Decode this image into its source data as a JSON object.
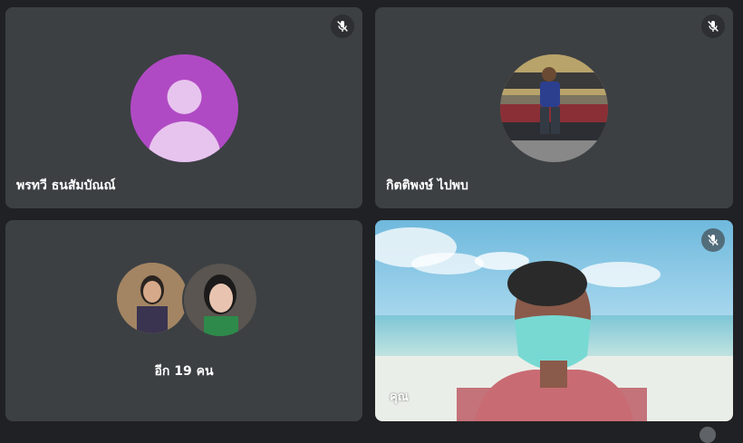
{
  "participants": [
    {
      "name": "พรทวี ธนสัมบัณณ์",
      "muted": true,
      "avatar": "default-person-avatar",
      "avatar_color": "#b04ac4"
    },
    {
      "name": "กิตติพงษ์ ไปพบ",
      "muted": true,
      "avatar": "photo-avatar"
    }
  ],
  "others": {
    "label": "อีก 19 คน",
    "avatars": [
      "photo-avatar-woman-1",
      "photo-avatar-woman-2"
    ]
  },
  "self": {
    "label": "คุณ",
    "muted": true,
    "video": "self-video-beach-background"
  },
  "icons": {
    "mute": "mic-off-icon"
  },
  "colors": {
    "tile_bg": "#3c4043",
    "page_bg": "#202124"
  }
}
